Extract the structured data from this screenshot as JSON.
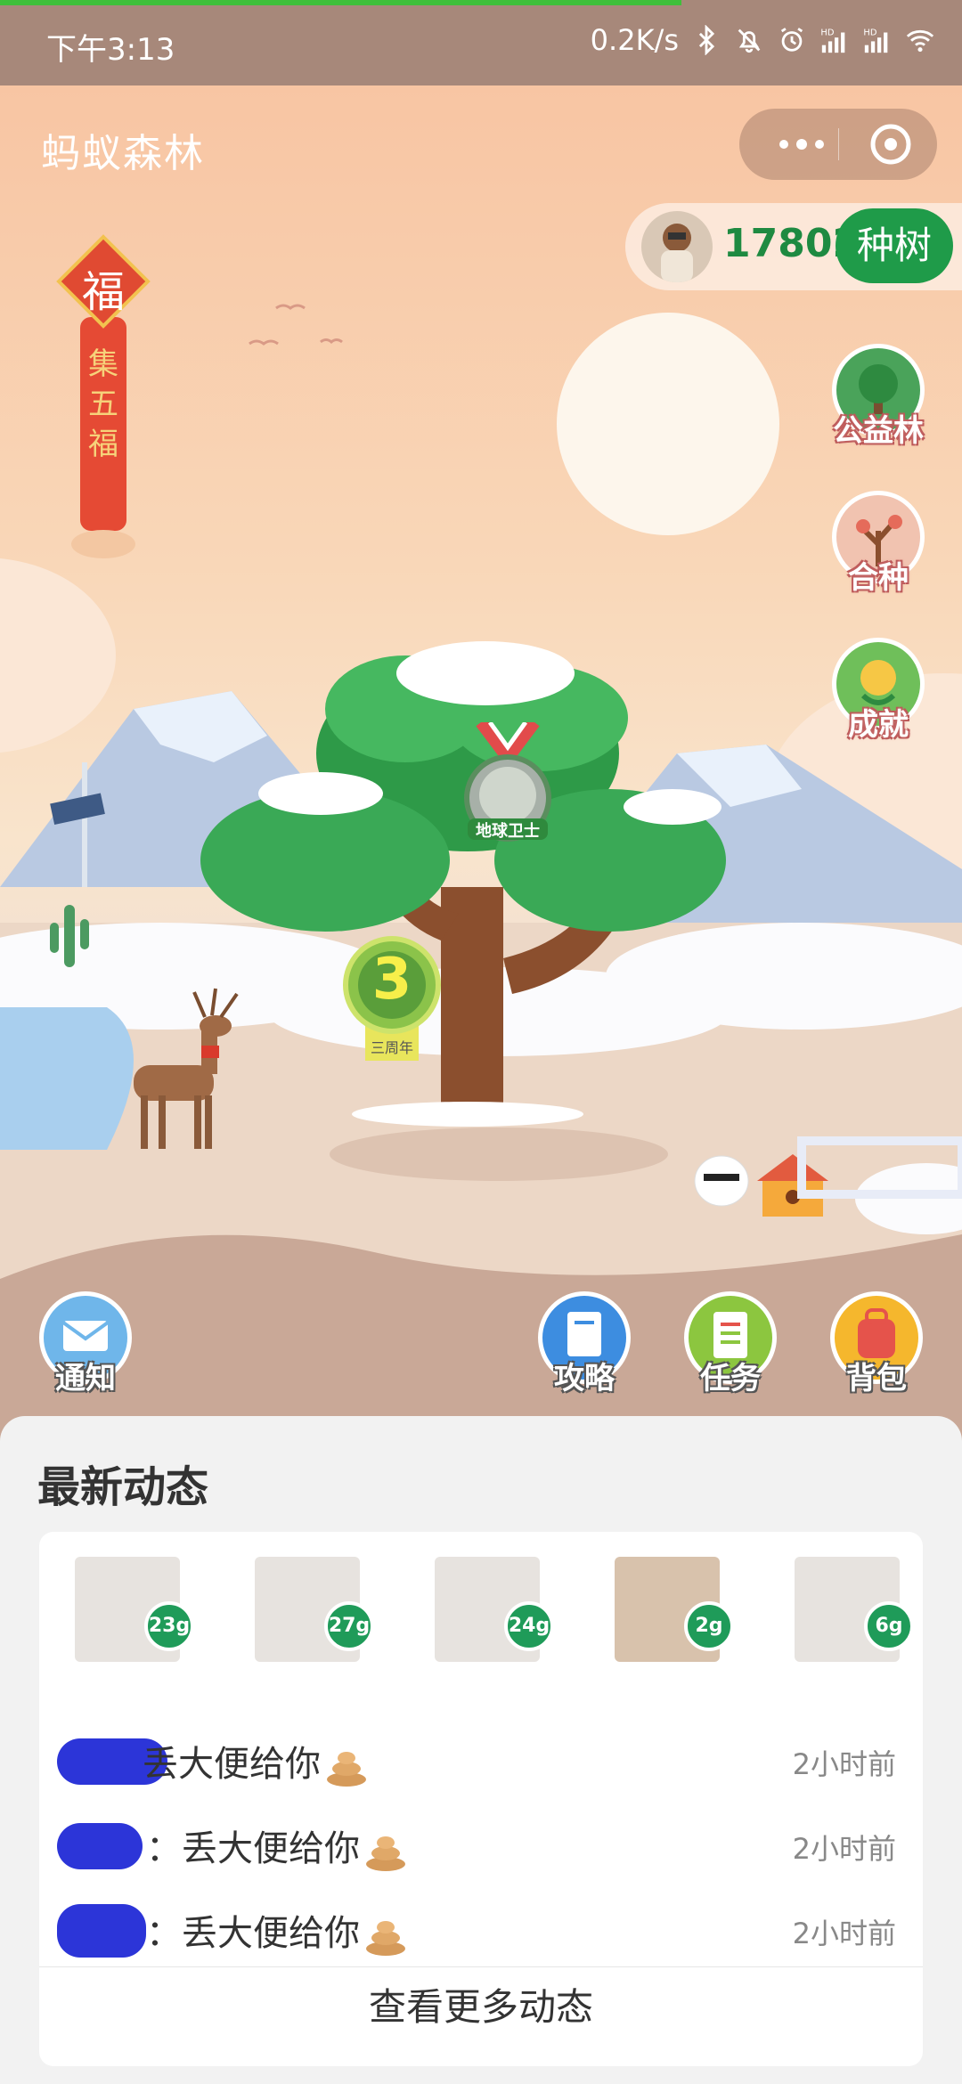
{
  "status_bar": {
    "time": "下午3:13",
    "net_speed": "0.2K/s",
    "icons": [
      "bluetooth-icon",
      "mute-bell-icon",
      "alarm-icon",
      "hd-signal-icon",
      "hd-signal-icon",
      "wifi-icon"
    ],
    "hd_label": "HD"
  },
  "header": {
    "title": "蚂蚁森林",
    "more_icon": "more-dots-icon",
    "close_icon": "close-target-icon"
  },
  "energy": {
    "amount": "17802g",
    "plant_label": "种树"
  },
  "fu_banner": {
    "char": "福",
    "label_lines": [
      "集",
      "五",
      "福"
    ]
  },
  "side_buttons": [
    {
      "id": "public-forest",
      "label": "公益林"
    },
    {
      "id": "co-plant",
      "label": "合种"
    },
    {
      "id": "achievements",
      "label": "成就"
    }
  ],
  "tree": {
    "medal_label": "地球卫士",
    "anniversary_number": "3",
    "anniversary_label": "三周年"
  },
  "bottom_buttons": [
    {
      "id": "notice",
      "label": "通知"
    },
    {
      "id": "guide",
      "label": "攻略"
    },
    {
      "id": "tasks",
      "label": "任务"
    },
    {
      "id": "bag",
      "label": "背包"
    }
  ],
  "feed": {
    "title": "最新动态",
    "friends": [
      {
        "energy": "23g"
      },
      {
        "energy": "27g"
      },
      {
        "energy": "24g"
      },
      {
        "energy": "2g"
      },
      {
        "energy": "6g"
      }
    ],
    "items": [
      {
        "separator": "",
        "message": "丢大便给你",
        "time": "2小时前"
      },
      {
        "separator": "：",
        "message": "丢大便给你",
        "time": "2小时前"
      },
      {
        "separator": "：",
        "message": "丢大便给你",
        "time": "2小时前"
      }
    ],
    "more_label": "查看更多动态"
  },
  "colors": {
    "brand_green": "#1f9b49",
    "energy_green": "#1e8a41",
    "status_bar": "#a7887a"
  }
}
